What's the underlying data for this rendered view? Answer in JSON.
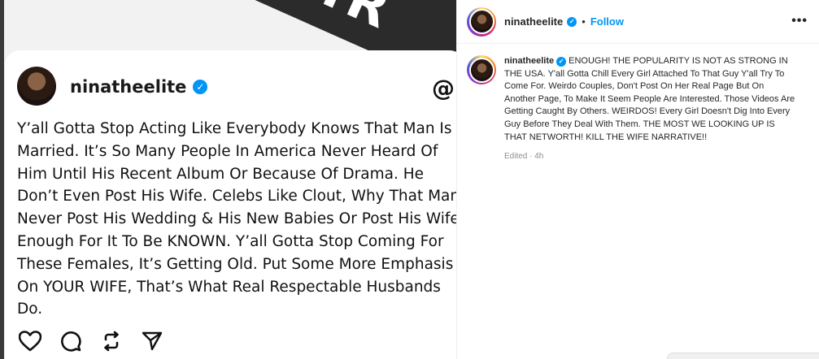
{
  "post_image": {
    "banner_text": "THR",
    "card": {
      "username": "ninatheelite",
      "text": "Y’all Gotta Stop Acting Like Everybody Knows That Man Is Married. It’s So Many People In America Never Heard Of Him Until His Recent Album Or Because Of Drama. He Don’t Even Post His Wife. Celebs Like Clout, Why That Man Never Post His Wedding & His New Babies Or Post His Wife Enough For It To Be KNOWN. Y’all Gotta Stop Coming For These Females, It’s Getting Old. Put Some More Emphasis On YOUR WIFE, That’s What Real Respectable Husbands Do.",
      "icons": [
        "heart-icon",
        "comment-icon",
        "repost-icon",
        "share-icon",
        "threads-logo-icon"
      ]
    }
  },
  "panel": {
    "header": {
      "username": "ninatheelite",
      "separator": "•",
      "follow_label": "Follow",
      "more_label": "•••"
    },
    "caption": {
      "username": "ninatheelite",
      "text": "ENOUGH! THE POPULARITY IS NOT AS STRONG IN THE USA. Y'all Gotta Chill Every Girl Attached To That Guy Y'all Try To Come For. Weirdo Couples, Don't Post On Her Real Page But On Another Page, To Make It Seem People Are Interested. Those Videos Are Getting Caught By Others. WEIRDOS! Every Girl Doesn't Dig Into Every Guy Before They Deal With Them. THE MOST WE LOOKING UP IS THAT NETWORTH! KILL THE WIFE NARRATIVE!!",
      "meta": "Edited · 4h"
    }
  },
  "colors": {
    "accent": "#0095f6",
    "text": "#262626",
    "muted": "#8e8e8e"
  }
}
